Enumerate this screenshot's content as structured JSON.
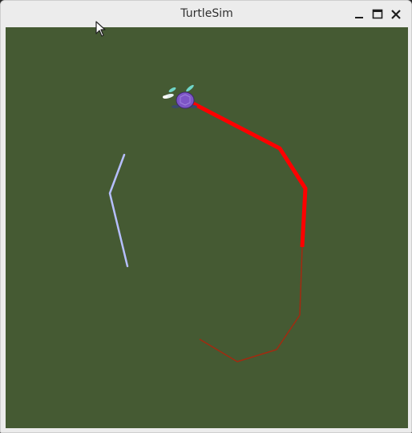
{
  "window": {
    "title": "TurtleSim",
    "buttons": [
      "minimize-icon",
      "maximize-icon",
      "close-icon"
    ]
  },
  "canvas": {
    "background_color": "#455a33"
  },
  "trails": [
    {
      "name": "blue-trail",
      "color": "#b6bfff"
    },
    {
      "name": "red-thick-trail",
      "color": "#ff0000"
    },
    {
      "name": "red-thin-trail",
      "color": "#a32a10"
    }
  ],
  "turtle": {
    "icon": "turtle-icon",
    "shell_color": "#7d55c7"
  },
  "cursor": {
    "icon": "mouse-pointer-icon"
  }
}
